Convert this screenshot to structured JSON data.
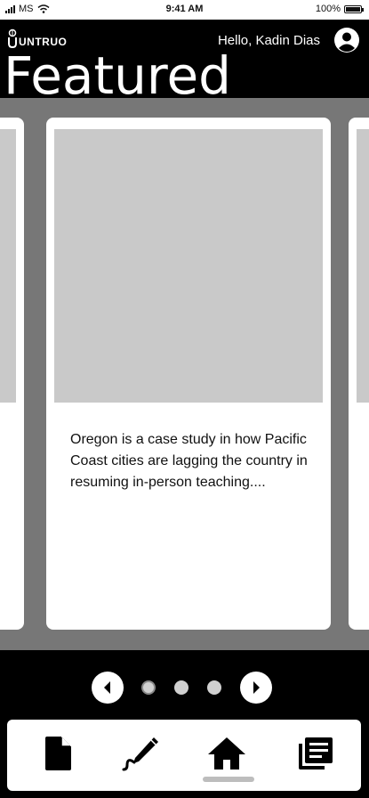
{
  "status_bar": {
    "carrier": "MS",
    "time": "9:41 AM",
    "battery": "100%"
  },
  "header": {
    "logo": "UNTRUO",
    "greeting": "Hello, Kadin Dias",
    "title": "Featured"
  },
  "cards": [
    {
      "text": ""
    },
    {
      "text": "Oregon is a case study in how Pacific Coast cities are lagging the country in resuming in-person teaching...."
    },
    {
      "text": ""
    }
  ],
  "pager": {
    "page_count": 3,
    "active_index": 0
  },
  "tabs": [
    {
      "name": "document",
      "icon": "document-icon"
    },
    {
      "name": "write",
      "icon": "quill-pen-icon"
    },
    {
      "name": "home",
      "icon": "home-icon",
      "active": true
    },
    {
      "name": "library",
      "icon": "library-icon"
    }
  ]
}
